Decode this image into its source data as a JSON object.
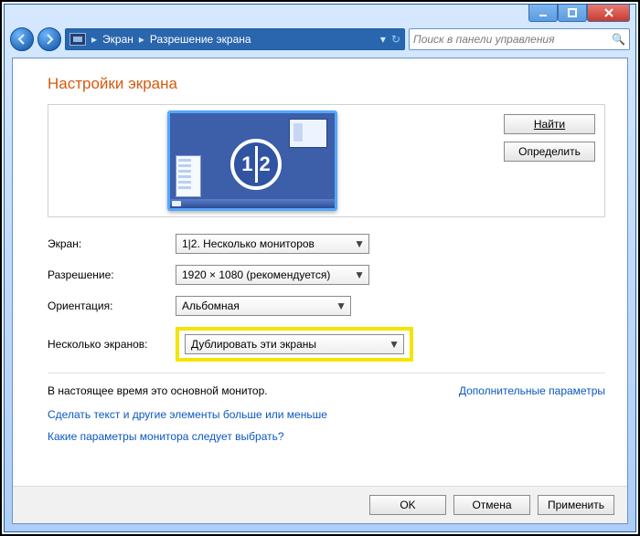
{
  "breadcrumb": {
    "seg1": "Экран",
    "seg2": "Разрешение экрана"
  },
  "search": {
    "placeholder": "Поиск в панели управления"
  },
  "page": {
    "title": "Настройки экрана"
  },
  "side_buttons": {
    "find": "Найти",
    "identify": "Определить"
  },
  "monitor_badge": {
    "left": "1",
    "right": "2"
  },
  "labels": {
    "screen": "Экран:",
    "resolution": "Разрешение:",
    "orientation": "Ориентация:",
    "multi": "Несколько экранов:"
  },
  "values": {
    "screen": "1|2. Несколько мониторов",
    "resolution": "1920 × 1080 (рекомендуется)",
    "orientation": "Альбомная",
    "multi": "Дублировать эти экраны"
  },
  "status": {
    "primary": "В настоящее время это основной монитор.",
    "advanced": "Дополнительные параметры"
  },
  "links": {
    "text_size": "Сделать текст и другие элементы больше или меньше",
    "which_settings": "Какие параметры монитора следует выбрать?"
  },
  "footer": {
    "ok": "OK",
    "cancel": "Отмена",
    "apply": "Применить"
  }
}
